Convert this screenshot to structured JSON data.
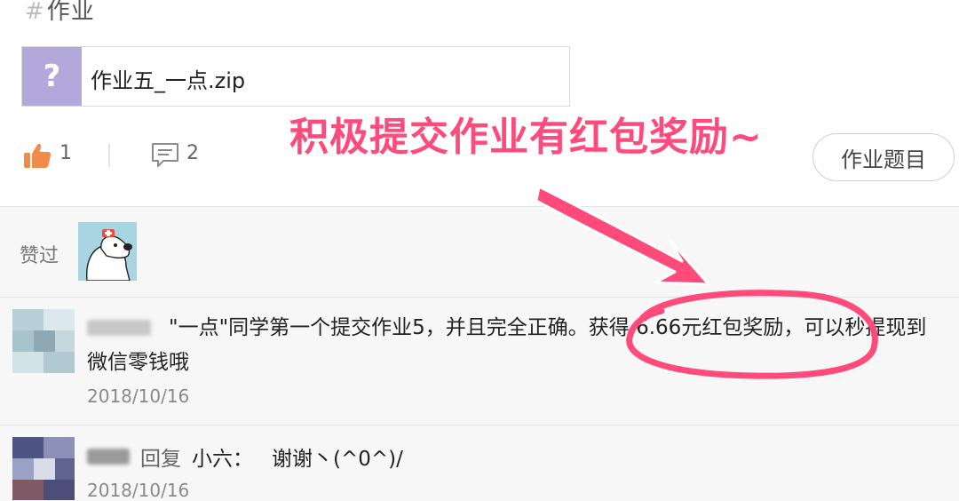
{
  "header": {
    "hash": "#",
    "tag": "作业"
  },
  "attachment": {
    "icon_glyph": "?",
    "filename": "作业五_一点.zip",
    "icon": "unknown-file-icon",
    "icon_color": "#b3a8dc"
  },
  "actions": {
    "like_icon": "thumbs-up-icon",
    "like_count": "1",
    "comment_icon": "comment-icon",
    "comment_count": "2",
    "task_button": "作业题目"
  },
  "annotation": {
    "banner": "积极提交作业有红包奖励~",
    "color": "#ff4b7c"
  },
  "liked": {
    "label": "赞过"
  },
  "comments": [
    {
      "text": "\"一点\"同学第一个提交作业5，并且完全正确。获得 6.66元红包奖励，可以秒提现到微信零钱哦",
      "date": "2018/10/16"
    },
    {
      "reply_label": "回复",
      "reply_to": "小六：",
      "text": "谢谢丶(^0^)/",
      "date": "2018/10/16"
    }
  ]
}
